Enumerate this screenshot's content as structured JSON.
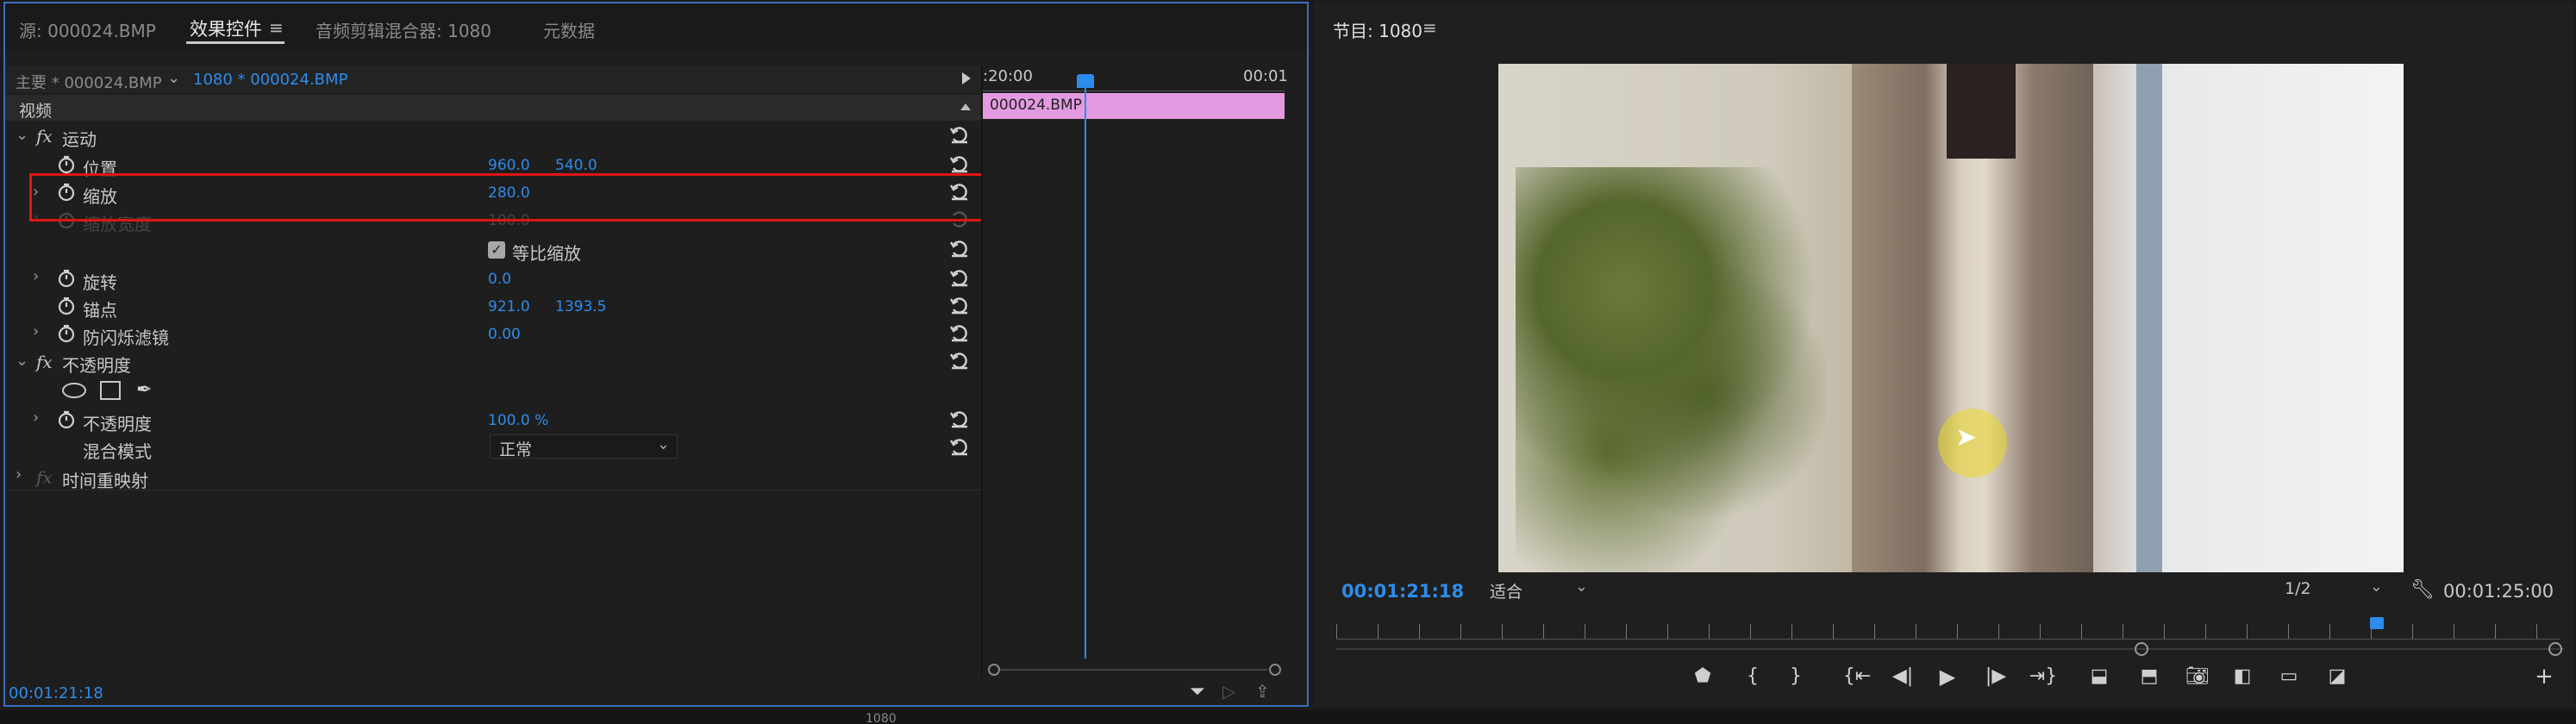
{
  "tabs": {
    "source": "源: 000024.BMP",
    "effect_controls": "效果控件",
    "audio_mixer": "音频剪辑混合器: 1080",
    "metadata": "元数据",
    "program": "节目: 1080"
  },
  "effect_controls": {
    "master_clip": "主要 * 000024.BMP",
    "sequence_clip": "1080 * 000024.BMP",
    "video_header": "视频",
    "motion": "运动",
    "position_label": "位置",
    "position_x": "960.0",
    "position_y": "540.0",
    "scale_label": "缩放",
    "scale_value": "280.0",
    "scale_width_label": "缩放宽度",
    "scale_width_value": "100.0",
    "uniform_scale_label": "等比缩放",
    "uniform_scale_checked": true,
    "rotation_label": "旋转",
    "rotation_value": "0.0",
    "anchor_label": "锚点",
    "anchor_x": "921.0",
    "anchor_y": "1393.5",
    "antiflicker_label": "防闪烁滤镜",
    "antiflicker_value": "0.00",
    "opacity_group": "不透明度",
    "opacity_label": "不透明度",
    "opacity_value": "100.0 %",
    "blend_mode_label": "混合模式",
    "blend_mode_value": "正常",
    "time_remap": "时间重映射",
    "timecode": "00:01:21:18"
  },
  "mini_timeline": {
    "start_time": ":20:00",
    "end_time": "00:01",
    "clip_name": "000024.BMP",
    "clip_color": "#e39ae0"
  },
  "program_monitor": {
    "current_time": "00:01:21:18",
    "zoom": "适合",
    "resolution": "1/2",
    "duration": "00:01:25:00",
    "playhead_fraction": 0.85
  },
  "bottom_tabs": {
    "partial_tab": "1080"
  },
  "colors": {
    "accent": "#2d8ceb",
    "highlight_box": "#e01515",
    "panel_border": "#3a6fbf"
  }
}
